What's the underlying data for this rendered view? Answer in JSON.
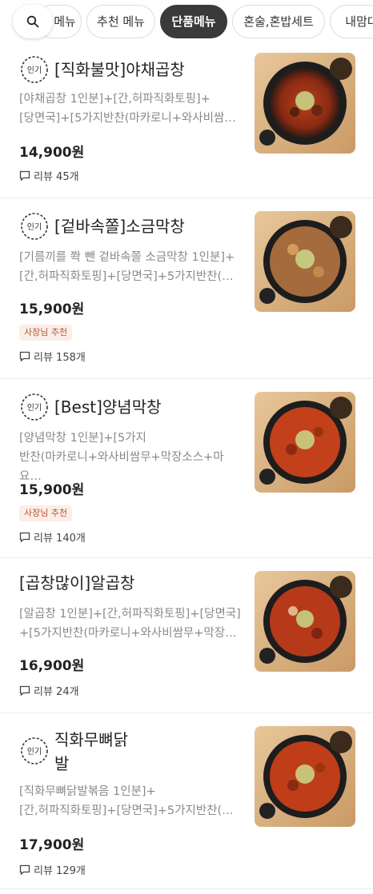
{
  "tabs": {
    "search_icon": "search-icon",
    "items": [
      {
        "label": "메뉴",
        "active": false
      },
      {
        "label": "추천 메뉴",
        "active": false
      },
      {
        "label": "단품메뉴",
        "active": true
      },
      {
        "label": "혼술,혼밥세트",
        "active": false
      },
      {
        "label": "내맘대",
        "active": false
      }
    ]
  },
  "colors": {
    "active_tab": "#3a3a3a",
    "badge_stroke": "#333333",
    "owner_tag_bg": "#fbeee6",
    "owner_tag_text": "#b7553a"
  },
  "menu": [
    {
      "popular_badge": "인기",
      "name": "[직화불맛]야채곱창",
      "desc_line1": "[야채곱창 1인분]+[간,허파직화토핑]+",
      "desc_line2": "[당면국]+[5가지반찬(마카로니+와사비쌈…",
      "price": "14,900원",
      "owner_pick": "",
      "review": "리뷰 45개"
    },
    {
      "popular_badge": "인기",
      "name": "[겉바속쫄]소금막창",
      "desc_line1": "[기름끼를 쫙 뺀 겉바속쫄 소금막창 1인분]+",
      "desc_line2": "[간,허파직화토핑]+[당면국]+5가지반찬(…",
      "price": "15,900원",
      "owner_pick": "사장님 추천",
      "review": "리뷰 158개"
    },
    {
      "popular_badge": "인기",
      "name": "[Best]양념막창",
      "desc_line1": "[양념막창 1인분]+[5가지",
      "desc_line2": "반찬(마카로니+와사비쌈무+막장소스+마요…",
      "price": "15,900원",
      "owner_pick": "사장님 추천",
      "review": "리뷰 140개"
    },
    {
      "popular_badge": "",
      "name": "[곱창많이]알곱창",
      "desc_line1": "[알곱창 1인분]+[간,허파직화토핑]+[당면국]",
      "desc_line2": "+[5가지반찬(마카로니+와사비쌈무+막장…",
      "price": "16,900원",
      "owner_pick": "",
      "review": "리뷰 24개"
    },
    {
      "popular_badge": "인기",
      "name_line1": "직화무뼈닭",
      "name_line2": "발",
      "desc_line1": "[직화무뼈닭발볶음 1인분]+",
      "desc_line2": "[간,허파직화토핑]+[당면국]+5가지반찬(…",
      "price": "17,900원",
      "owner_pick": "",
      "review": "리뷰 129개"
    }
  ]
}
